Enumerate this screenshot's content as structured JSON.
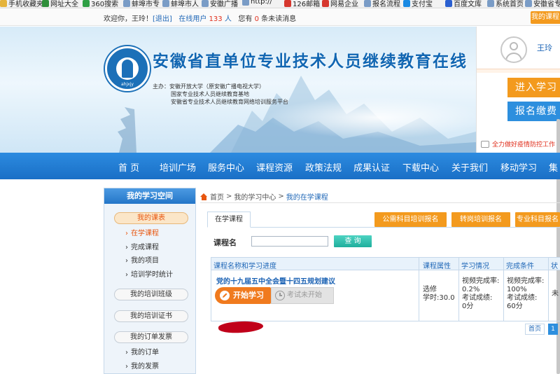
{
  "bookmarks": [
    {
      "label": "手机收藏夹",
      "icon": "folder-icon",
      "color": "#e5b33b"
    },
    {
      "label": "网址大全",
      "icon": "bookmark-icon",
      "color": "#2f8f3a"
    },
    {
      "label": "360搜索",
      "icon": "search-icon",
      "color": "#2f9f44"
    },
    {
      "label": "蚌埠市专",
      "icon": "page-icon",
      "color": "#7a9cc6"
    },
    {
      "label": "蚌埠市人",
      "icon": "page-icon",
      "color": "#7a9cc6"
    },
    {
      "label": "安徽广播",
      "icon": "page-icon",
      "color": "#7a9cc6"
    },
    {
      "label": "http://",
      "icon": "page-icon",
      "color": "#7a9cc6"
    },
    {
      "label": "126邮箱",
      "icon": "mail-icon",
      "color": "#d6372e"
    },
    {
      "label": "网易企业",
      "icon": "mail-icon",
      "color": "#d6372e"
    },
    {
      "label": "报名流程",
      "icon": "page-icon",
      "color": "#7a9cc6"
    },
    {
      "label": "支付宝",
      "icon": "pay-icon",
      "color": "#1a8ae3"
    },
    {
      "label": "百度文库",
      "icon": "doc-icon",
      "color": "#2a5fd0"
    },
    {
      "label": "系统首页",
      "icon": "page-icon",
      "color": "#7a9cc6"
    },
    {
      "label": "安徽省专",
      "icon": "page-icon",
      "color": "#7a9cc6"
    }
  ],
  "topbar": {
    "welcome_prefix": "欢迎你，王玲！",
    "logout": "[退出]",
    "online_prefix": "在线用户",
    "online_count": "133",
    "online_suffix": "人",
    "msg_prefix": "您有",
    "msg_count": "0",
    "msg_suffix": "条未读消息",
    "my_course_btn": "我的课程"
  },
  "banner": {
    "logo_text": "ahjxjy",
    "title": "安徽省直单位专业技术人员继续教育在线",
    "sponsor_lines": [
      "主办：安徽开放大学（原安徽广播电视大学）",
      "国家专业技术人员继续教育基地",
      "安徽省专业技术人员继续教育网络培训服务平台"
    ]
  },
  "userpanel": {
    "username": "王玲",
    "enter_btn": "进入学习",
    "pay_btn": "报名缴费",
    "notice": "全力做好疫情防控工作"
  },
  "nav": [
    "首 页",
    "培训广场",
    "服务中心",
    "课程资源",
    "政策法规",
    "成果认证",
    "下载中心",
    "关于我们",
    "移动学习",
    "集"
  ],
  "sidebar": {
    "title": "我的学习空间",
    "groups": [
      {
        "label": "我的课表",
        "active": true
      },
      {
        "label": "我的培训班级"
      },
      {
        "label": "我的培训证书"
      },
      {
        "label": "我的订单发票"
      }
    ],
    "course_items": [
      {
        "label": "在学课程",
        "active": true
      },
      {
        "label": "完成课程"
      },
      {
        "label": "我的项目"
      },
      {
        "label": "培训学时统计"
      }
    ],
    "order_items": [
      {
        "label": "我的订单"
      },
      {
        "label": "我的发票"
      }
    ]
  },
  "breadcrumb": {
    "home": "首页",
    "sep": ">",
    "level1": "我的学习中心",
    "current": "我的在学课程"
  },
  "tabs": {
    "current": "在学课程",
    "buttons": [
      "公需科目培训报名",
      "转岗培训报名",
      "专业科目报名"
    ]
  },
  "search": {
    "label": "课程名",
    "value": "",
    "button": "查 询"
  },
  "table": {
    "headers": [
      "课程名称和学习进度",
      "课程属性",
      "学习情况",
      "完成条件",
      "状"
    ],
    "rows": [
      {
        "course_name": "党的十九届五中全会暨十四五规划建议",
        "start_btn": "开始学习",
        "exam_btn": "考试未开始",
        "attr_type": "选修",
        "attr_hours": "学时:30.0",
        "progress_label": "视频完成率:",
        "progress_value": "0.2%",
        "score_label": "考试成绩:",
        "score_value": "0分",
        "req_label": "视频完成率:",
        "req_value": "100%",
        "req_score_label": "考试成绩:",
        "req_score_value": "60分",
        "status": "未"
      }
    ]
  },
  "pagination": {
    "first": "首页",
    "current": "1"
  },
  "colors": {
    "brand_blue": "#1a6fc6",
    "accent_orange": "#f39a1e",
    "link_blue": "#1f67b7",
    "alert_red": "#e0301e"
  }
}
